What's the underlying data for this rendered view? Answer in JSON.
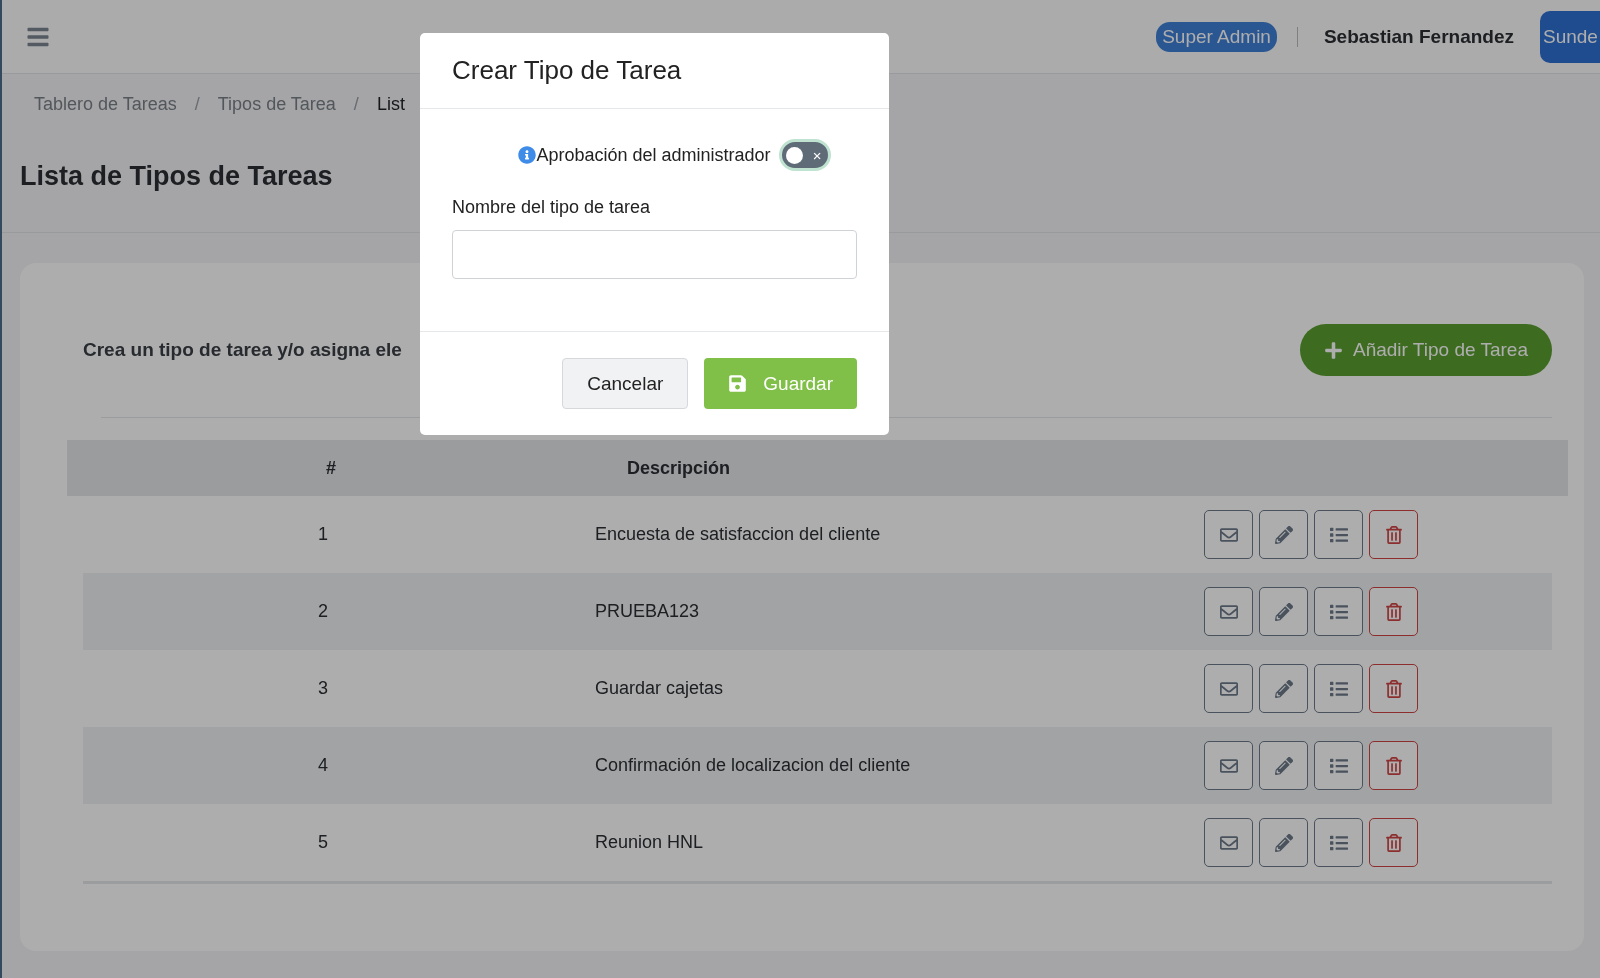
{
  "header": {
    "role_badge": "Super Admin",
    "user_name": "Sebastian Fernandez",
    "avatar_button": "Sunde"
  },
  "breadcrumb": [
    {
      "label": "Tablero de Tareas",
      "current": false
    },
    {
      "separator": "/",
      "label": "Tipos de Tarea",
      "current": false
    },
    {
      "separator": "/",
      "label": "List",
      "current": true
    }
  ],
  "page_title": "Lista de Tipos de Tareas",
  "card": {
    "description": "Crea un tipo de tarea y/o asigna ele",
    "add_button": "Añadir Tipo de Tarea"
  },
  "table": {
    "columns": [
      "#",
      "Descripción"
    ],
    "rows": [
      {
        "number": "1",
        "description": "Encuesta de satisfaccion del cliente"
      },
      {
        "number": "2",
        "description": "PRUEBA123"
      },
      {
        "number": "3",
        "description": "Guardar cajetas"
      },
      {
        "number": "4",
        "description": "Confirmación de localizacion del cliente"
      },
      {
        "number": "5",
        "description": "Reunion HNL"
      }
    ]
  },
  "modal": {
    "title": "Crear Tipo de Tarea",
    "admin_approval": {
      "label": "Aprobación del administrador",
      "on": false,
      "off_mark": "×"
    },
    "name_label": "Nombre del tipo de tarea",
    "buttons": {
      "cancel": "Cancelar",
      "save": "Guardar"
    }
  }
}
